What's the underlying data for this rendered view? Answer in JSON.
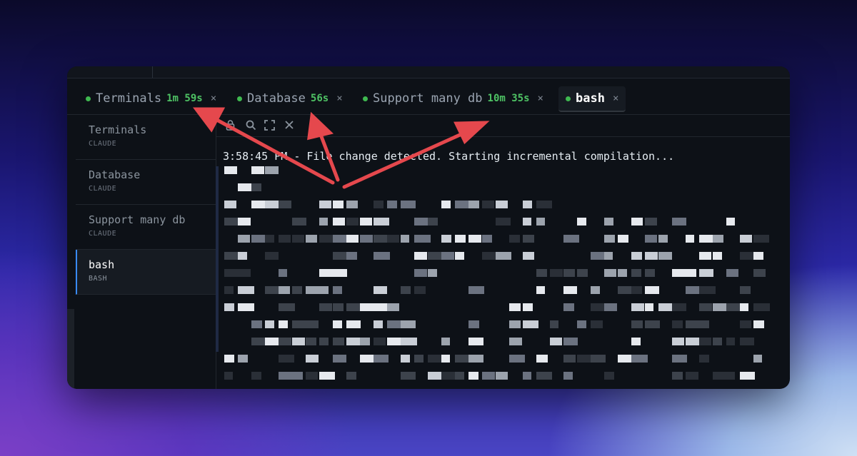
{
  "tabs": [
    {
      "label": "Terminals",
      "time": "1m 59s",
      "close": "×"
    },
    {
      "label": "Database",
      "time": "56s",
      "close": "×"
    },
    {
      "label": "Support many db",
      "time": "10m 35s",
      "close": "×"
    },
    {
      "label": "bash",
      "time": "",
      "close": "×"
    }
  ],
  "sidebar": {
    "items": [
      {
        "title": "Terminals",
        "sub": "CLAUDE"
      },
      {
        "title": "Database",
        "sub": "CLAUDE"
      },
      {
        "title": "Support many db",
        "sub": "CLAUDE"
      },
      {
        "title": "bash",
        "sub": "BASH"
      }
    ]
  },
  "terminal": {
    "line1": "3:58:45 PM - File change detected. Starting incremental compilation..."
  },
  "colors": {
    "accent": "#388bfd",
    "status_dot": "#3fb950",
    "arrow": "#e5484d"
  },
  "icons": [
    "lock-icon",
    "search-icon",
    "expand-icon",
    "close-icon"
  ]
}
